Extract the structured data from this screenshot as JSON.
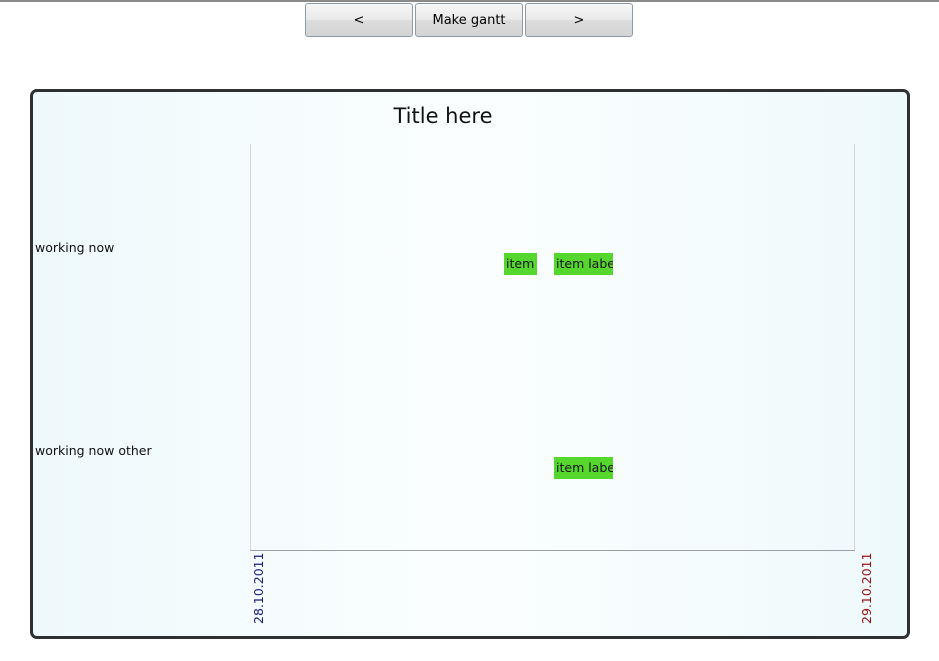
{
  "toolbar": {
    "prev_label": "<",
    "make_label": "Make gantt",
    "next_label": ">"
  },
  "chart_data": {
    "type": "gantt",
    "title": "Title here",
    "x_start_label": "28.10.2011",
    "x_end_label": "29.10.2011",
    "x_start_color": "#1a1a7a",
    "x_end_color": "#9a1010",
    "bar_color": "#55d72e",
    "rows": [
      {
        "label": "working now",
        "items": [
          {
            "label": "item",
            "start": 0.42,
            "end": 0.475
          },
          {
            "label": "item labe",
            "start": 0.503,
            "end": 0.6
          }
        ]
      },
      {
        "label": "working now other",
        "items": [
          {
            "label": "item labe",
            "start": 0.503,
            "end": 0.6
          }
        ]
      }
    ]
  }
}
